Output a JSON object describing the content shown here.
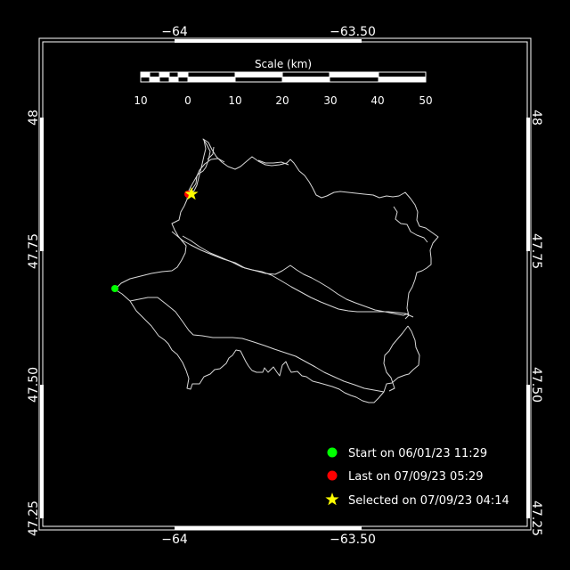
{
  "map": {
    "x_ticks": [
      "−64",
      "−63.50"
    ],
    "y_ticks": [
      "47.25",
      "47.50",
      "47.75",
      "48"
    ],
    "scale": {
      "title": "Scale (km)",
      "labels": [
        "10",
        "0",
        "10",
        "20",
        "30",
        "40",
        "50"
      ]
    },
    "legend": {
      "start_label": "Start on 06/01/23 11:29",
      "last_label": "Last on 07/09/23 05:29",
      "selected_label": "Selected on 07/09/23 04:14"
    },
    "colors": {
      "background": "#000000",
      "frame": "#ffffff",
      "track": "#d9d9d9",
      "start": "#00ff00",
      "last": "#ff0000",
      "selected": "#ffff00"
    },
    "icons": {
      "start": "green-dot-icon",
      "last": "red-dot-icon",
      "selected": "yellow-star-icon"
    }
  }
}
